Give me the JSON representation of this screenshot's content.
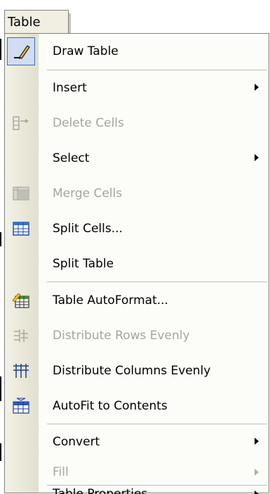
{
  "menu_title": "Table",
  "items": [
    {
      "label": "Draw Table",
      "icon": "pencil-icon",
      "enabled": true,
      "submenu": false,
      "checked": true
    },
    {
      "label": "Insert",
      "icon": "",
      "enabled": true,
      "submenu": true
    },
    {
      "label": "Delete Cells",
      "icon": "delete-cells-icon",
      "enabled": false,
      "submenu": false
    },
    {
      "label": "Select",
      "icon": "",
      "enabled": true,
      "submenu": true
    },
    {
      "label": "Merge Cells",
      "icon": "merge-cells-icon",
      "enabled": false,
      "submenu": false
    },
    {
      "label": "Split Cells...",
      "icon": "split-cells-icon",
      "enabled": true,
      "submenu": false
    },
    {
      "label": "Split Table",
      "icon": "",
      "enabled": true,
      "submenu": false
    },
    {
      "label": "Table AutoFormat...",
      "icon": "table-autoformat-icon",
      "enabled": true,
      "submenu": false
    },
    {
      "label": "Distribute Rows Evenly",
      "icon": "distribute-rows-icon",
      "enabled": false,
      "submenu": false
    },
    {
      "label": "Distribute Columns Evenly",
      "icon": "distribute-columns-icon",
      "enabled": true,
      "submenu": false
    },
    {
      "label": "AutoFit to Contents",
      "icon": "autofit-icon",
      "enabled": true,
      "submenu": false
    },
    {
      "label": "Convert",
      "icon": "",
      "enabled": true,
      "submenu": true
    },
    {
      "label": "Fill",
      "icon": "",
      "enabled": false,
      "submenu": true
    },
    {
      "label": "Table Properties",
      "icon": "",
      "enabled": true,
      "submenu": true
    }
  ],
  "colors": {
    "disabled_text": "#a6a59b",
    "icon_column": "#e1dfcd",
    "selection_border": "#316ac5"
  }
}
